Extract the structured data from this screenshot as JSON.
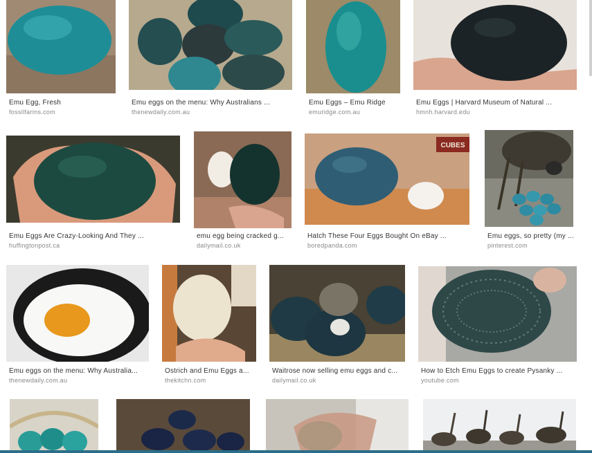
{
  "results": [
    {
      "caption": "Emu Egg, Fresh",
      "source": "fossilfarms.com"
    },
    {
      "caption": "Emu eggs on the menu: Why Australians ...",
      "source": "thenewdaily.com.au"
    },
    {
      "caption": "Emu Eggs – Emu Ridge",
      "source": "emuridge.com.au"
    },
    {
      "caption": "Emu Eggs | Harvard Museum of Natural ...",
      "source": "hmnh.harvard.edu"
    },
    {
      "caption": "Emu Eggs Are Crazy-Looking And They ...",
      "source": "huffingtonpost.ca"
    },
    {
      "caption": "emu egg being cracked g...",
      "source": "dailymail.co.uk"
    },
    {
      "caption": "Hatch These Four Eggs Bought On eBay ...",
      "source": "boredpanda.com"
    },
    {
      "caption": "Emu eggs, so pretty (my ...",
      "source": "pinterest.com"
    },
    {
      "caption": "Emu eggs on the menu: Why Australia...",
      "source": "thenewdaily.com.au"
    },
    {
      "caption": "Ostrich and Emu Eggs a...",
      "source": "thekitchn.com"
    },
    {
      "caption": "Waitrose now selling emu eggs and c...",
      "source": "dailymail.co.uk"
    },
    {
      "caption": "How to Etch Emu Eggs to create Pysanky ...",
      "source": "youtube.com"
    }
  ],
  "image_text": {
    "cubes": "CUBES"
  },
  "colors": {
    "caption": "#333333",
    "source": "#888888",
    "accent_bar": "#2b6e89"
  }
}
